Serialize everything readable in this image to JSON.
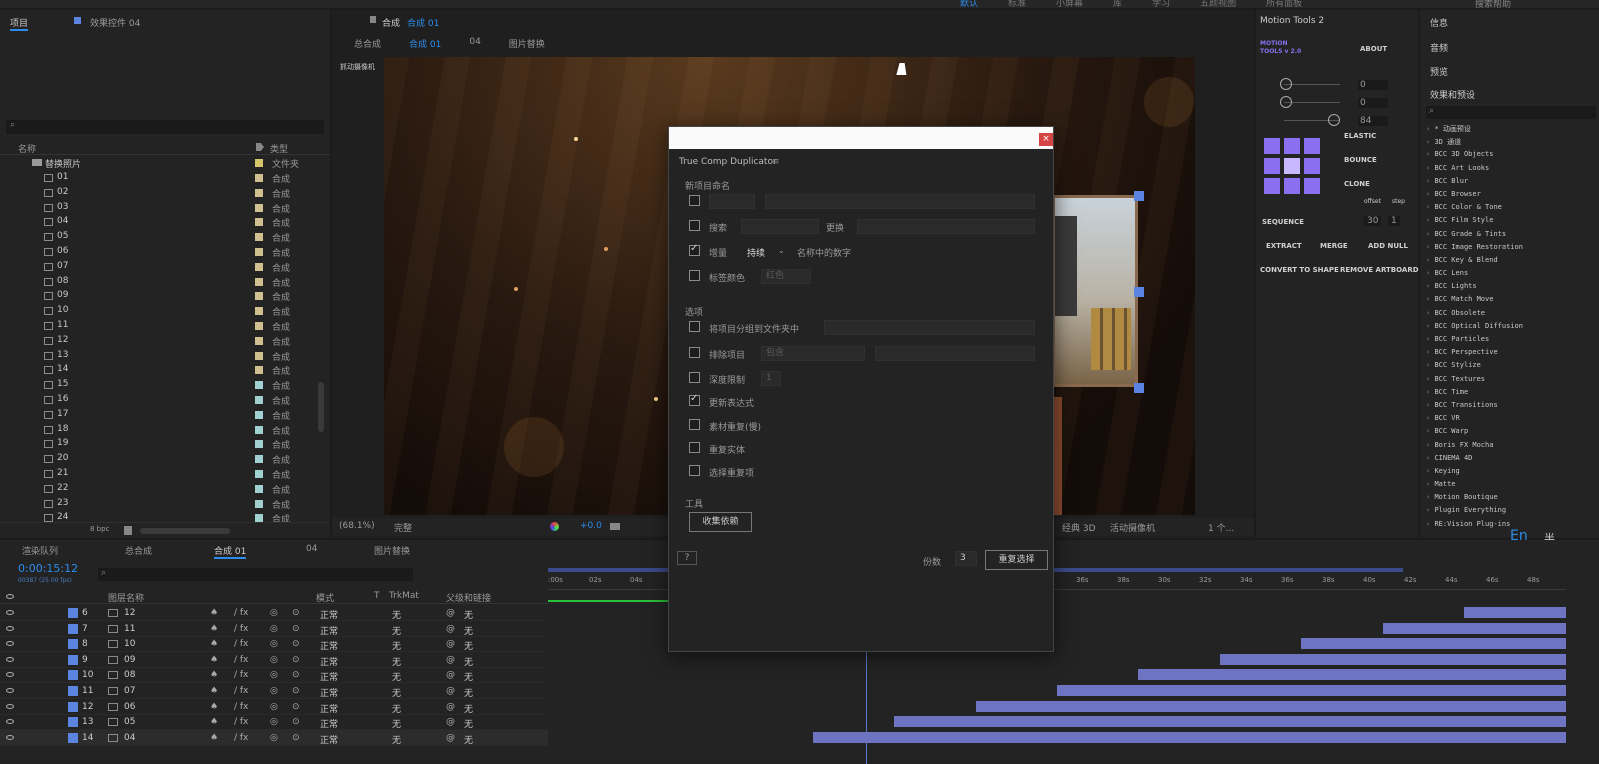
{
  "top_menu": [
    "默认",
    "标准",
    "小屏幕",
    "库",
    "学习",
    "五颜视图",
    "所有面板"
  ],
  "search_help": "搜索帮助",
  "project_panel": {
    "tab": "项目",
    "effects_tab": "效果控件 04",
    "col_name": "名称",
    "col_type": "类型",
    "folder": "替换照片",
    "folder_type": "文件夹",
    "type_comp": "合成",
    "bpc": "8 bpc",
    "items": [
      "01",
      "02",
      "03",
      "04",
      "05",
      "06",
      "07",
      "08",
      "09",
      "10",
      "11",
      "12",
      "13",
      "14",
      "15",
      "16",
      "17",
      "18",
      "19",
      "20",
      "21",
      "22",
      "23",
      "24"
    ]
  },
  "comp_viewer": {
    "tab_prefix": "合成",
    "tab_name": "合成 01",
    "breadcrumbs": [
      "总合成",
      "合成 01",
      "04",
      "图片替换"
    ],
    "left_label": "抓动摄像机",
    "zoom": "(68.1%)",
    "quality": "完整",
    "exposure": "+0.0",
    "view": "经典 3D",
    "camera": "活动摄像机",
    "views": "1 个..."
  },
  "dialog": {
    "title": "True Comp Duplicator",
    "section_naming": "新项目命名",
    "search": "搜索",
    "replace": "更换",
    "increment": "增量",
    "increment_mode": "持续",
    "increment_desc": "名称中的数字",
    "label_color": "标签颜色",
    "label_color_val": "红色",
    "section_options": "选项",
    "group_folder": "将项目分组到文件夹中",
    "exclude_items": "排除项目",
    "exclude_val": "包含",
    "depth_limit": "深度限制",
    "depth_val": "1",
    "update_expr": "更新表达式",
    "footage_dup": "素材重复(慢)",
    "dup_solids": "重复实体",
    "select_dups": "选择重复项",
    "section_tools": "工具",
    "collect_deps": "收集依赖",
    "help": "?",
    "copies_label": "份数",
    "copies_val": "3",
    "duplicate_btn": "重复选择"
  },
  "motion_tools": {
    "title": "Motion Tools 2",
    "logo": "MOTION TOOLS v 2.0",
    "about": "ABOUT",
    "vals": [
      "0",
      "0",
      "84"
    ],
    "elastic": "ELASTIC",
    "bounce": "BOUNCE",
    "clone": "CLONE",
    "offset": "offset",
    "step": "step",
    "sequence": "SEQUENCE",
    "seq_vals": [
      "30",
      "1"
    ],
    "extract": "EXTRACT",
    "merge": "MERGE",
    "add_null": "ADD NULL",
    "convert": "CONVERT TO SHAPE",
    "remove_artboard": "REMOVE ARTBOARD"
  },
  "effects_panel": {
    "info": "信息",
    "audio": "音频",
    "preview": "预览",
    "title": "效果和预设",
    "items": [
      "* 动画预设",
      "3D 通道",
      "BCC 3D Objects",
      "BCC Art Looks",
      "BCC Blur",
      "BCC Browser",
      "BCC Color & Tone",
      "BCC Film Style",
      "BCC Grade & Tints",
      "BCC Image Restoration",
      "BCC Key & Blend",
      "BCC Lens",
      "BCC Lights",
      "BCC Match Move",
      "BCC Obsolete",
      "BCC Optical Diffusion",
      "BCC Particles",
      "BCC Perspective",
      "BCC Stylize",
      "BCC Textures",
      "BCC Time",
      "BCC Transitions",
      "BCC VR",
      "BCC Warp",
      "Boris FX Mocha",
      "CINEMA 4D",
      "Keying",
      "Matte",
      "Motion Boutique",
      "Plugin Everything",
      "RE:Vision Plug-ins"
    ],
    "ime": "En",
    "ime2": "半"
  },
  "timeline": {
    "tabs": [
      "渲染队列",
      "总合成",
      "合成 01",
      "04",
      "图片替换"
    ],
    "timecode": "0:00:15:12",
    "fps": "00387 (25.00 fps)",
    "col_layer": "图层名称",
    "col_mode": "模式",
    "col_t": "T",
    "col_trkmat": "TrkMat",
    "col_parent": "父级和链接",
    "mode": "正常",
    "none": "无",
    "ruler": [
      ":00s",
      "02s",
      "04s",
      "36s",
      "38s",
      "30s",
      "32s",
      "34s",
      "36s",
      "38s",
      "40s",
      "42s",
      "44s",
      "46s",
      "48s"
    ],
    "layers": [
      {
        "n": "6",
        "name": "12"
      },
      {
        "n": "7",
        "name": "11"
      },
      {
        "n": "8",
        "name": "10"
      },
      {
        "n": "9",
        "name": "09"
      },
      {
        "n": "10",
        "name": "08"
      },
      {
        "n": "11",
        "name": "07"
      },
      {
        "n": "12",
        "name": "06"
      },
      {
        "n": "13",
        "name": "05"
      },
      {
        "n": "14",
        "name": "04"
      }
    ],
    "bar_starts": [
      0.9,
      0.82,
      0.74,
      0.66,
      0.58,
      0.5,
      0.42,
      0.34,
      0.26
    ]
  },
  "colors": {
    "accent": "#2d8ceb",
    "bar": "#6f74c2",
    "label_blue": "#5b84e0"
  }
}
